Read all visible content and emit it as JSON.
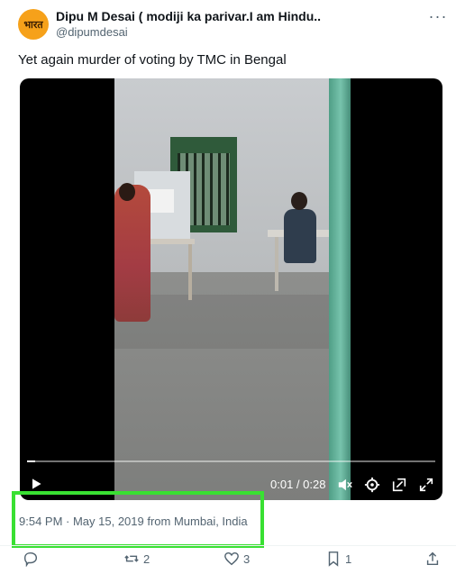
{
  "tweet": {
    "avatar_text": "भारत",
    "display_name": "Dipu M Desai ( modiji ka parivar.I am Hindu..",
    "handle": "@dipumdesai",
    "more_icon": "more-horizontal-icon",
    "text": "Yet again murder of voting by TMC in Bengal",
    "meta": "9:54 PM · May 15, 2019 from Mumbai, India"
  },
  "video": {
    "time": "0:01 / 0:28",
    "progress": 0.02,
    "controls": [
      "play-icon",
      "mute-icon",
      "settings-icon",
      "pip-icon",
      "fullscreen-icon"
    ]
  },
  "actions": {
    "reply_count": "",
    "retweet_count": "2",
    "like_count": "3",
    "bookmark_count": "1"
  },
  "colors": {
    "highlight_box": "#39e032",
    "secondary_text": "#536471"
  }
}
